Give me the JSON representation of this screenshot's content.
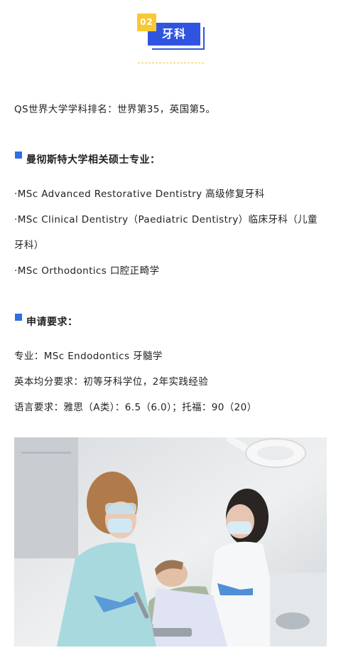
{
  "header": {
    "number": "02",
    "title": "牙科"
  },
  "ranking": "QS世界大学学科排名：世界第35，英国第5。",
  "programs": {
    "heading": "曼彻斯特大学相关硕士专业：",
    "items": [
      "·MSc Advanced Restorative Dentistry 高级修复牙科",
      "·MSc Clinical Dentistry（Paediatric Dentistry）临床牙科（儿童",
      "牙科）",
      "·MSc Orthodontics 口腔正畸学"
    ]
  },
  "requirements": {
    "heading": "申请要求：",
    "major": "专业：MSc Endodontics 牙髓学",
    "gpa": "英本均分要求：初等牙科学位，2年实践经验",
    "language": "语言要求：雅思（A类）：6.5（6.0）；托福：90（20）"
  },
  "colors": {
    "accent_blue": "#2f55e0",
    "accent_yellow": "#f7c935",
    "bullet_blue": "#2f6fe6"
  }
}
